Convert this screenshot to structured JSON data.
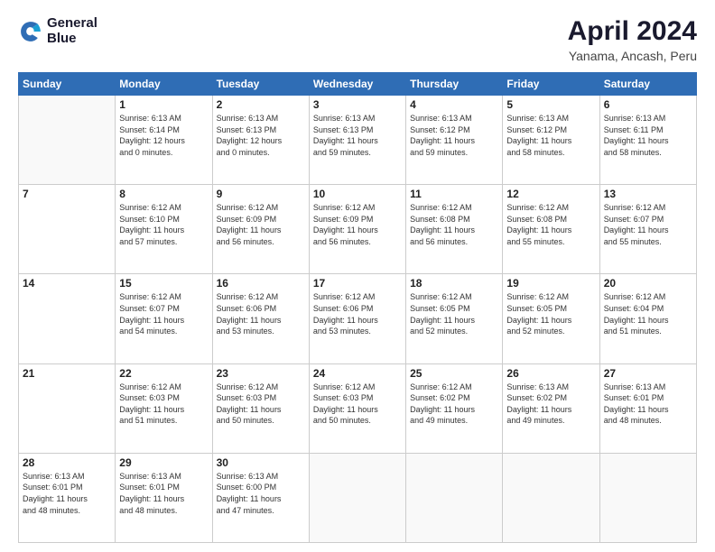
{
  "header": {
    "logo_line1": "General",
    "logo_line2": "Blue",
    "title": "April 2024",
    "subtitle": "Yanama, Ancash, Peru"
  },
  "calendar": {
    "days_of_week": [
      "Sunday",
      "Monday",
      "Tuesday",
      "Wednesday",
      "Thursday",
      "Friday",
      "Saturday"
    ],
    "weeks": [
      [
        {
          "day": "",
          "info": ""
        },
        {
          "day": "1",
          "info": "Sunrise: 6:13 AM\nSunset: 6:14 PM\nDaylight: 12 hours\nand 0 minutes."
        },
        {
          "day": "2",
          "info": "Sunrise: 6:13 AM\nSunset: 6:13 PM\nDaylight: 12 hours\nand 0 minutes."
        },
        {
          "day": "3",
          "info": "Sunrise: 6:13 AM\nSunset: 6:13 PM\nDaylight: 11 hours\nand 59 minutes."
        },
        {
          "day": "4",
          "info": "Sunrise: 6:13 AM\nSunset: 6:12 PM\nDaylight: 11 hours\nand 59 minutes."
        },
        {
          "day": "5",
          "info": "Sunrise: 6:13 AM\nSunset: 6:12 PM\nDaylight: 11 hours\nand 58 minutes."
        },
        {
          "day": "6",
          "info": "Sunrise: 6:13 AM\nSunset: 6:11 PM\nDaylight: 11 hours\nand 58 minutes."
        }
      ],
      [
        {
          "day": "7",
          "info": ""
        },
        {
          "day": "8",
          "info": "Sunrise: 6:12 AM\nSunset: 6:10 PM\nDaylight: 11 hours\nand 57 minutes."
        },
        {
          "day": "9",
          "info": "Sunrise: 6:12 AM\nSunset: 6:09 PM\nDaylight: 11 hours\nand 56 minutes."
        },
        {
          "day": "10",
          "info": "Sunrise: 6:12 AM\nSunset: 6:09 PM\nDaylight: 11 hours\nand 56 minutes."
        },
        {
          "day": "11",
          "info": "Sunrise: 6:12 AM\nSunset: 6:08 PM\nDaylight: 11 hours\nand 56 minutes."
        },
        {
          "day": "12",
          "info": "Sunrise: 6:12 AM\nSunset: 6:08 PM\nDaylight: 11 hours\nand 55 minutes."
        },
        {
          "day": "13",
          "info": "Sunrise: 6:12 AM\nSunset: 6:07 PM\nDaylight: 11 hours\nand 55 minutes."
        }
      ],
      [
        {
          "day": "14",
          "info": ""
        },
        {
          "day": "15",
          "info": "Sunrise: 6:12 AM\nSunset: 6:07 PM\nDaylight: 11 hours\nand 54 minutes."
        },
        {
          "day": "16",
          "info": "Sunrise: 6:12 AM\nSunset: 6:06 PM\nDaylight: 11 hours\nand 53 minutes."
        },
        {
          "day": "17",
          "info": "Sunrise: 6:12 AM\nSunset: 6:06 PM\nDaylight: 11 hours\nand 53 minutes."
        },
        {
          "day": "18",
          "info": "Sunrise: 6:12 AM\nSunset: 6:05 PM\nDaylight: 11 hours\nand 52 minutes."
        },
        {
          "day": "19",
          "info": "Sunrise: 6:12 AM\nSunset: 6:05 PM\nDaylight: 11 hours\nand 52 minutes."
        },
        {
          "day": "20",
          "info": "Sunrise: 6:12 AM\nSunset: 6:04 PM\nDaylight: 11 hours\nand 51 minutes."
        }
      ],
      [
        {
          "day": "21",
          "info": ""
        },
        {
          "day": "22",
          "info": "Sunrise: 6:12 AM\nSunset: 6:03 PM\nDaylight: 11 hours\nand 51 minutes."
        },
        {
          "day": "23",
          "info": "Sunrise: 6:12 AM\nSunset: 6:03 PM\nDaylight: 11 hours\nand 50 minutes."
        },
        {
          "day": "24",
          "info": "Sunrise: 6:12 AM\nSunset: 6:03 PM\nDaylight: 11 hours\nand 50 minutes."
        },
        {
          "day": "25",
          "info": "Sunrise: 6:12 AM\nSunset: 6:02 PM\nDaylight: 11 hours\nand 49 minutes."
        },
        {
          "day": "26",
          "info": "Sunrise: 6:13 AM\nSunset: 6:02 PM\nDaylight: 11 hours\nand 49 minutes."
        },
        {
          "day": "27",
          "info": "Sunrise: 6:13 AM\nSunset: 6:01 PM\nDaylight: 11 hours\nand 48 minutes."
        }
      ],
      [
        {
          "day": "28",
          "info": "Sunrise: 6:13 AM\nSunset: 6:01 PM\nDaylight: 11 hours\nand 48 minutes."
        },
        {
          "day": "29",
          "info": "Sunrise: 6:13 AM\nSunset: 6:01 PM\nDaylight: 11 hours\nand 48 minutes."
        },
        {
          "day": "30",
          "info": "Sunrise: 6:13 AM\nSunset: 6:00 PM\nDaylight: 11 hours\nand 47 minutes."
        },
        {
          "day": "",
          "info": ""
        },
        {
          "day": "",
          "info": ""
        },
        {
          "day": "",
          "info": ""
        },
        {
          "day": "",
          "info": ""
        }
      ]
    ]
  }
}
